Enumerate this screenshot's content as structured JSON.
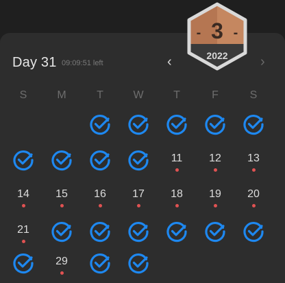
{
  "header": {
    "title": "Day 31",
    "subtitle": "09:09:51 left",
    "prev_label": "‹",
    "next_label": "›"
  },
  "badge": {
    "number": "3",
    "left_mark": "-",
    "right_mark": "-",
    "year": "2022"
  },
  "weekdays": [
    "S",
    "M",
    "T",
    "W",
    "T",
    "F",
    "S"
  ],
  "days": [
    {
      "label": "",
      "state": "completed"
    },
    {
      "label": "",
      "state": "completed"
    },
    {
      "label": "",
      "state": "completed"
    },
    {
      "label": "",
      "state": "completed"
    },
    {
      "label": "",
      "state": "completed"
    },
    {
      "label": "",
      "state": "completed"
    },
    {
      "label": "",
      "state": "completed"
    },
    {
      "label": "",
      "state": "completed"
    },
    {
      "label": "",
      "state": "completed"
    },
    {
      "label": "11",
      "state": "missed"
    },
    {
      "label": "12",
      "state": "missed"
    },
    {
      "label": "13",
      "state": "missed"
    },
    {
      "label": "14",
      "state": "missed"
    },
    {
      "label": "15",
      "state": "missed"
    },
    {
      "label": "16",
      "state": "missed"
    },
    {
      "label": "17",
      "state": "missed"
    },
    {
      "label": "18",
      "state": "missed"
    },
    {
      "label": "19",
      "state": "missed"
    },
    {
      "label": "20",
      "state": "missed"
    },
    {
      "label": "21",
      "state": "missed"
    },
    {
      "label": "",
      "state": "completed"
    },
    {
      "label": "",
      "state": "completed"
    },
    {
      "label": "",
      "state": "completed"
    },
    {
      "label": "",
      "state": "completed"
    },
    {
      "label": "",
      "state": "completed"
    },
    {
      "label": "",
      "state": "completed"
    },
    {
      "label": "",
      "state": "completed"
    },
    {
      "label": "29",
      "state": "missed"
    },
    {
      "label": "",
      "state": "completed"
    },
    {
      "label": "",
      "state": "completed"
    }
  ],
  "colors": {
    "check": "#1e88f0",
    "missed_dot": "#e05252",
    "badge_top": "#c58760",
    "badge_bottom": "#3a3a3a",
    "badge_border": "#d9d9d9"
  }
}
